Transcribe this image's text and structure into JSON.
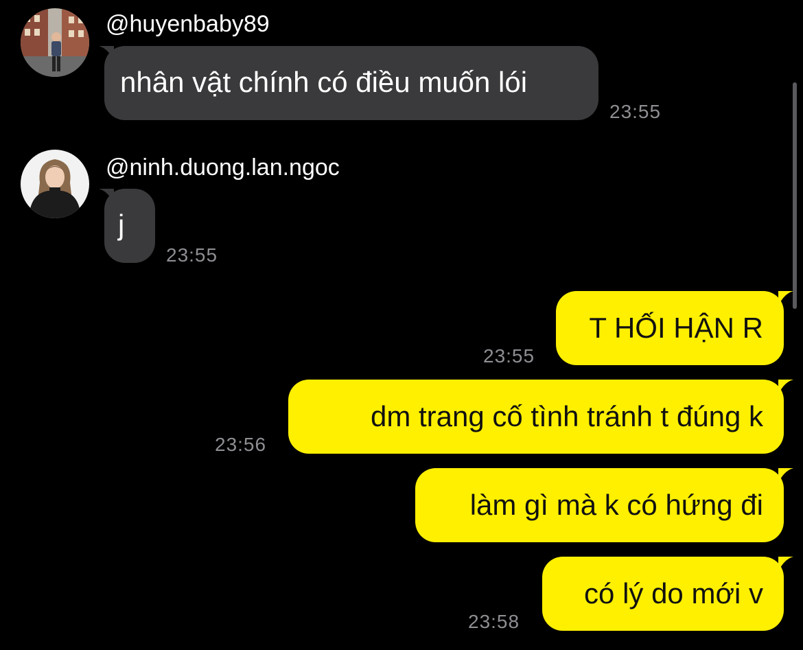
{
  "colors": {
    "background": "#000000",
    "incoming_bubble": "#3a3a3c",
    "outgoing_bubble": "#fff000",
    "timestamp": "#8e8e93"
  },
  "messages": [
    {
      "direction": "incoming",
      "username": "@huyenbaby89",
      "avatar_icon": "user-photo-avatar",
      "text": "nhân vật chính có điều muốn lói",
      "time": "23:55"
    },
    {
      "direction": "incoming",
      "username": "@ninh.duong.lan.ngoc",
      "avatar_icon": "user-photo-avatar",
      "text": "j",
      "time": "23:55"
    },
    {
      "direction": "outgoing",
      "text": "T HỐI HẬN R",
      "time": "23:55"
    },
    {
      "direction": "outgoing",
      "text": "dm trang cố tình tránh t đúng k",
      "time": "23:56"
    },
    {
      "direction": "outgoing",
      "text": "làm gì mà k có hứng đi",
      "time": ""
    },
    {
      "direction": "outgoing",
      "text": "có lý do mới v",
      "time": "23:58"
    }
  ]
}
